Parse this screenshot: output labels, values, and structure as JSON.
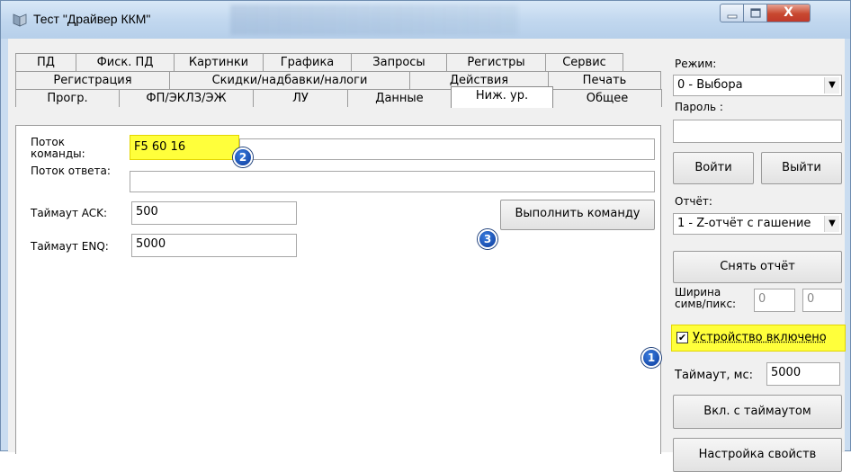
{
  "window": {
    "title": "Тест \"Драйвер ККМ\"",
    "close_glyph": "X"
  },
  "tabs": {
    "row1": [
      "ПД",
      "Фиск. ПД",
      "Картинки",
      "Графика",
      "Запросы",
      "Регистры",
      "Сервис"
    ],
    "row2": [
      "Регистрация",
      "Скидки/надбавки/налоги",
      "Действия",
      "Печать"
    ],
    "row3": [
      "Прогр.",
      "ФП/ЭКЛЗ/ЭЖ",
      "ЛУ",
      "Данные",
      "Ниж. ур.",
      "Общее"
    ],
    "active": "Ниж. ур."
  },
  "form": {
    "command_label": "Поток команды:",
    "command_value": "F5 60 16",
    "response_label": "Поток ответа:",
    "response_value": "",
    "ack_label": "Таймаут ACK:",
    "ack_value": "500",
    "enq_label": "Таймаут ENQ:",
    "enq_value": "5000",
    "execute_button": "Выполнить команду"
  },
  "badges": [
    "1",
    "2",
    "3"
  ],
  "right_panel": {
    "mode_label": "Режим:",
    "mode_value": "0 - Выбора",
    "password_label": "Пароль :",
    "password_value": "",
    "login_button": "Войти",
    "logout_button": "Выйти",
    "report_label": "Отчёт:",
    "report_value": "1 - Z-отчёт с гашение",
    "take_report_button": "Снять отчёт",
    "width_label": "Ширина симв/пикс:",
    "width_chars": "0",
    "width_pixels": "0",
    "device_enabled_label": "Устройство включено",
    "device_enabled": true,
    "timeout_label": "Таймаут, мс:",
    "timeout_value": "5000",
    "timeout_button": "Вкл. с таймаутом",
    "properties_button": "Настройка свойств"
  },
  "colors": {
    "highlight": "#ffff3b",
    "badge": "#1f5cc4"
  }
}
